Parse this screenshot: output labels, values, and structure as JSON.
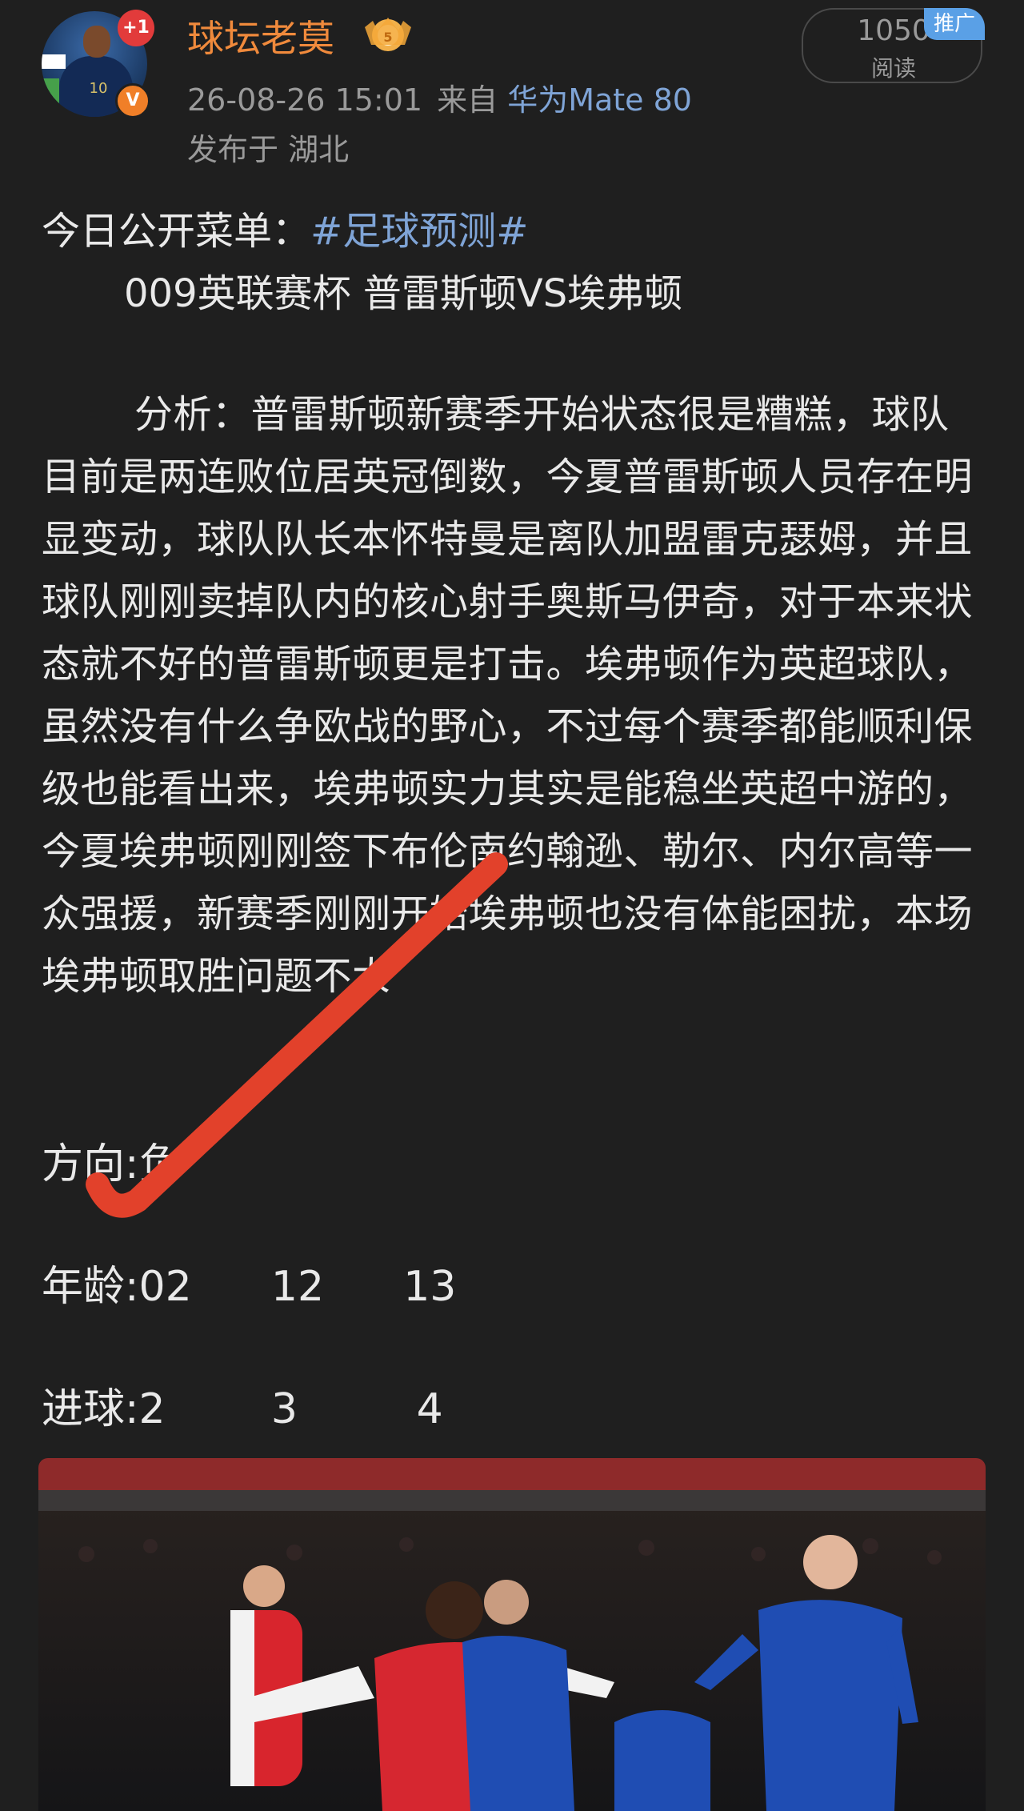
{
  "post": {
    "author": "球坛老莫",
    "follow_badge": "+1",
    "verified_mark": "V",
    "timestamp": "26-08-26 15:01",
    "source_prefix": "来自",
    "device": "华为Mate 80",
    "location": "发布于 湖北",
    "read_count": "1050",
    "read_label": "阅读",
    "ad_tag": "推广"
  },
  "content": {
    "intro_prefix": "今日公开菜单：",
    "hashtag": "#足球预测#",
    "match_line": "009英联赛杯 普雷斯顿VS埃弗顿",
    "analysis": "分析：普雷斯顿新赛季开始状态很是糟糕，球队目前是两连败位居英冠倒数，今夏普雷斯顿人员存在明显变动，球队队长本怀特曼是离队加盟雷克瑟姆，并且球队刚刚卖掉队内的核心射手奥斯马伊奇，对于本来状态就不好的普雷斯顿更是打击。埃弗顿作为英超球队，虽然没有什么争欧战的野心，不过每个赛季都能顺利保级也能看出来，埃弗顿实力其实是能稳坐英超中游的，今夏埃弗顿刚刚签下布伦南约翰逊、勒尔、内尔高等一众强援，新赛季刚刚开始埃弗顿也没有体能困扰，本场埃弗顿取胜问题不大",
    "direction": "方向:负",
    "age": "年龄:02      12      13",
    "goals": "进球:2        3         4"
  },
  "icons": {
    "crown": "crown-level-badge-icon",
    "checkmark": "red-checkmark-icon"
  },
  "colors": {
    "background": "#1f1f1f",
    "author": "#f08a3c",
    "link": "#7fa4d6",
    "checkmark": "#e2412b",
    "ad_tag": "#5aa0e6"
  }
}
